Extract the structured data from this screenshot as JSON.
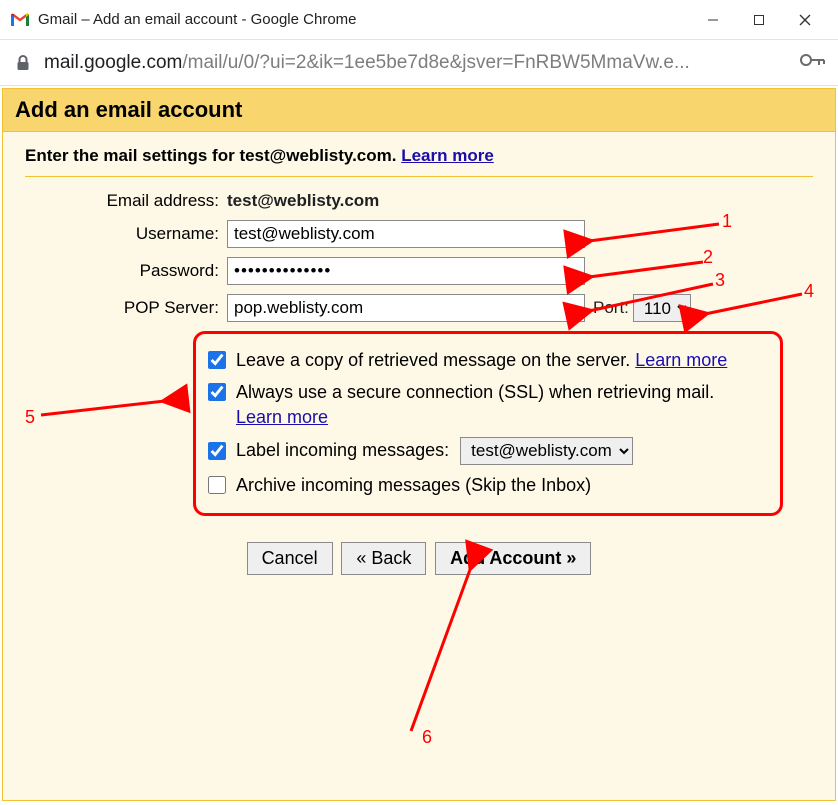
{
  "window": {
    "title": "Gmail – Add an email account - Google Chrome",
    "url_host": "mail.google.com",
    "url_rest": "/mail/u/0/?ui=2&ik=1ee5be7d8e&jsver=FnRBW5MmaVw.e..."
  },
  "header": {
    "title": "Add an email account"
  },
  "instruction": {
    "prefix": "Enter the mail settings for ",
    "email": "test@weblisty.com",
    "suffix": ". ",
    "learn_more": "Learn more"
  },
  "form": {
    "email_label": "Email address:",
    "email_value": "test@weblisty.com",
    "username_label": "Username:",
    "username_value": "test@weblisty.com",
    "password_label": "Password:",
    "password_value": "••••••••••••••",
    "pop_label": "POP Server:",
    "pop_value": "pop.weblisty.com",
    "port_label": "Port:",
    "port_value": "110"
  },
  "options": {
    "opt1_text": "Leave a copy of retrieved message on the server. ",
    "opt1_link": "Learn more",
    "opt2_text": "Always use a secure connection (SSL) when retrieving mail. ",
    "opt2_link": "Learn more",
    "opt3_text": "Label incoming messages:",
    "opt3_select": "test@weblisty.com",
    "opt4_text": "Archive incoming messages (Skip the Inbox)"
  },
  "buttons": {
    "cancel": "Cancel",
    "back": "« Back",
    "add": "Add Account »"
  },
  "annotations": {
    "n1": "1",
    "n2": "2",
    "n3": "3",
    "n4": "4",
    "n5": "5",
    "n6": "6"
  }
}
